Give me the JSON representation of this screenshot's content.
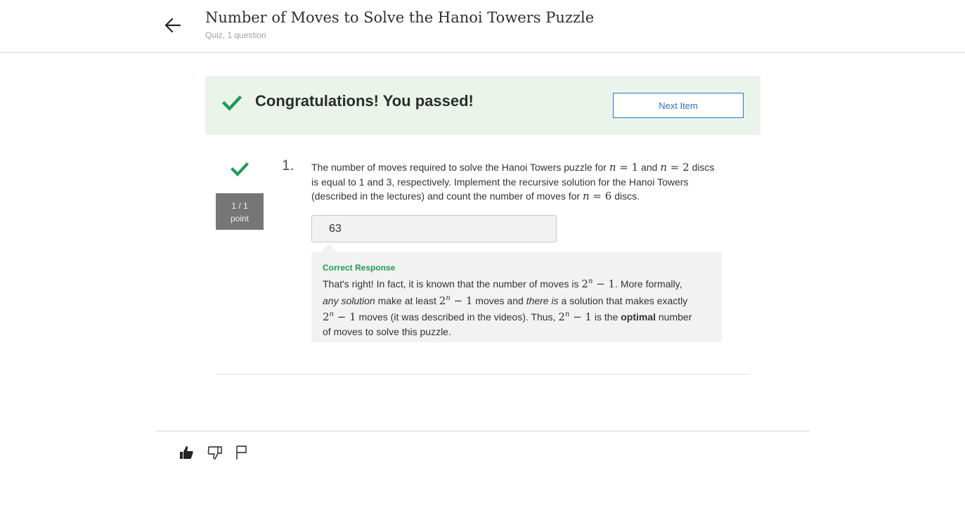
{
  "header": {
    "title": "Number of Moves to Solve the Hanoi Towers Puzzle",
    "subtitle": "Quiz, 1 question",
    "back_icon": "arrow-left-icon"
  },
  "banner": {
    "message": "Congratulations! You passed!",
    "next_label": "Next Item",
    "check_color": "#1f9a5a"
  },
  "question": {
    "number": "1.",
    "points_score": "1 / 1",
    "points_unit": "point",
    "text": {
      "p1": "The number of moves required to solve the Hanoi Towers puzzle for ",
      "n1_var": "n",
      "n1_eq": " = 1",
      "p2": " and ",
      "n2_var": "n",
      "n2_eq": " = 2",
      "p3": " discs is equal to 1 and 3, respectively. Implement the recursive solution for the Hanoi Towers (described in the lectures) and count the number of moves for ",
      "n3_var": "n",
      "n3_eq": " = 6",
      "p4": " discs."
    },
    "answer_value": "63"
  },
  "feedback": {
    "title": "Correct Response",
    "t1": "That's right! In fact, it is known that the number of moves is ",
    "t2": ". More formally, ",
    "em1": "any solution",
    "t3": " make at least ",
    "t4": " moves and ",
    "em2": "there is",
    "t5": " a solution that makes exactly ",
    "t6": " moves (it was described in the videos). Thus, ",
    "t7": " is the ",
    "strong": "optimal",
    "t8": " number of moves to solve this puzzle.",
    "formula_base": "2",
    "formula_exp": "n",
    "formula_rest": " − 1"
  },
  "footer": {
    "like_icon": "thumbs-up-icon",
    "dislike_icon": "thumbs-down-icon",
    "flag_icon": "flag-icon"
  }
}
